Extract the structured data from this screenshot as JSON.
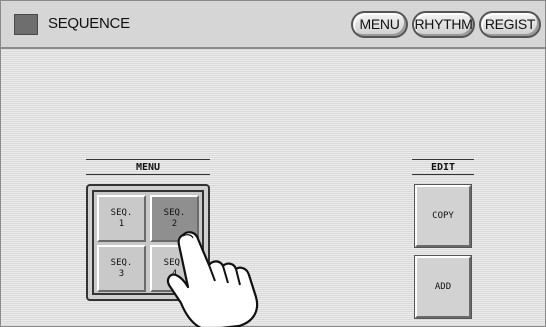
{
  "header": {
    "title": "SEQUENCE",
    "buttons": [
      {
        "label": "MENU"
      },
      {
        "label": "RHYTHM"
      },
      {
        "label": "REGIST"
      }
    ]
  },
  "menu_group": {
    "label": "MENU",
    "buttons": [
      {
        "line1": "SEQ.",
        "line2": "1",
        "active": false
      },
      {
        "line1": "SEQ.",
        "line2": "2",
        "active": true
      },
      {
        "line1": "SEQ.",
        "line2": "3",
        "active": false
      },
      {
        "line1": "SEQ.",
        "line2": "4",
        "active": false
      }
    ]
  },
  "edit_group": {
    "label": "EDIT",
    "copy_label": "COPY",
    "add_label": "ADD"
  },
  "icons": {
    "app": "sequence-app-icon",
    "pointer": "pointing-hand-icon"
  }
}
